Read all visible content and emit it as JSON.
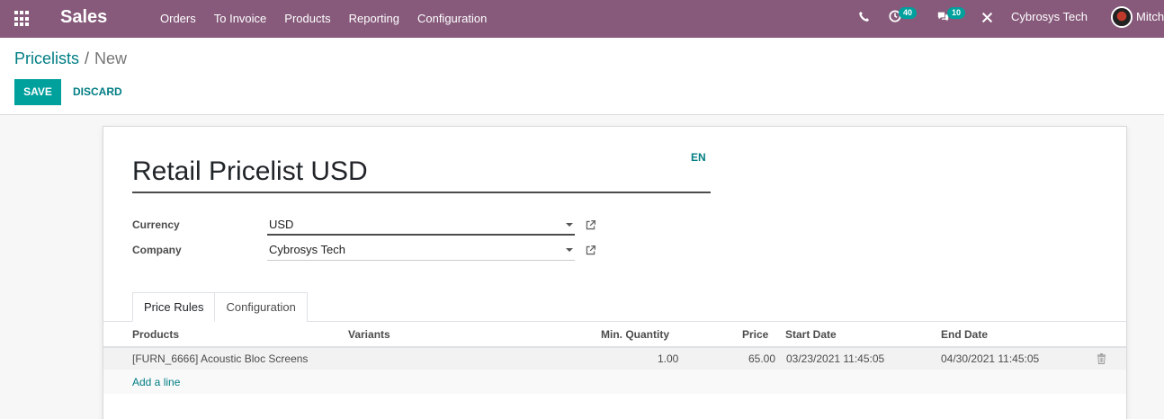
{
  "navbar": {
    "brand": "Sales",
    "menu": [
      "Orders",
      "To Invoice",
      "Products",
      "Reporting",
      "Configuration"
    ],
    "activity_count": "40",
    "message_count": "10",
    "company": "Cybrosys Tech",
    "user": "Mitch"
  },
  "breadcrumb": {
    "parent": "Pricelists",
    "separator": "/",
    "current": "New"
  },
  "actions": {
    "save": "SAVE",
    "discard": "DISCARD"
  },
  "form": {
    "title": "Retail Pricelist USD",
    "lang": "EN",
    "fields": [
      {
        "label": "Currency",
        "value": "USD"
      },
      {
        "label": "Company",
        "value": "Cybrosys Tech"
      }
    ],
    "tabs": [
      "Price Rules",
      "Configuration"
    ]
  },
  "table": {
    "columns": [
      "Products",
      "Variants",
      "Min. Quantity",
      "Price",
      "Start Date",
      "End Date"
    ],
    "rows": [
      {
        "product": "[FURN_6666] Acoustic Bloc Screens",
        "variants": "",
        "min_qty": "1.00",
        "price": "65.00",
        "start": "03/23/2021 11:45:05",
        "end": "04/30/2021 11:45:05"
      }
    ],
    "add_line": "Add a line"
  },
  "colors": {
    "navbar": "#875a7b",
    "accent": "#00a09d",
    "link": "#017e84"
  },
  "icons": [
    "apps-icon",
    "phone-icon",
    "activity-clock-icon",
    "chat-icon",
    "debug-tools-icon",
    "external-link-icon",
    "trash-icon",
    "dropdown-caret-icon"
  ]
}
